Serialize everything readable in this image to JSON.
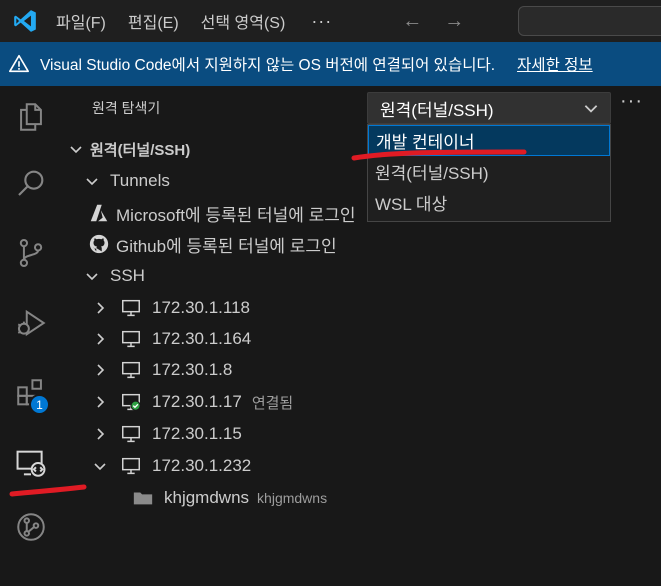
{
  "menu": [
    "파일(F)",
    "편집(E)",
    "선택 영역(S)"
  ],
  "menu_more": "···",
  "nav": {
    "back": "←",
    "forward": "→"
  },
  "banner": {
    "text": "Visual Studio Code에서 지원하지 않는 OS 버전에 연결되어 있습니다.",
    "link": "자세한 정보"
  },
  "activity": {
    "badge": "1"
  },
  "sidebar": {
    "title": "원격 탐색기",
    "select_value": "원격(터널/SSH)",
    "more": "···",
    "dropdown": [
      "개발 컨테이너",
      "원격(터널/SSH)",
      "WSL 대상"
    ],
    "section": "원격(터널/SSH)",
    "tunnels": {
      "label": "Tunnels",
      "microsoft": "Microsoft에 등록된 터널에 로그인",
      "github": "Github에 등록된 터널에 로그인"
    },
    "ssh": {
      "label": "SSH",
      "hosts": [
        {
          "name": "172.30.1.118",
          "desc": ""
        },
        {
          "name": "172.30.1.164",
          "desc": ""
        },
        {
          "name": "172.30.1.8",
          "desc": ""
        },
        {
          "name": "172.30.1.17",
          "desc": "연결됨"
        },
        {
          "name": "172.30.1.15",
          "desc": ""
        },
        {
          "name": "172.30.1.232",
          "desc": ""
        }
      ],
      "folder": {
        "name": "khjgmdwns",
        "desc": "khjgmdwns"
      }
    }
  },
  "colors": {
    "accent": "#0078d4",
    "banner": "#0a4c80",
    "annotation": "#e01b24"
  }
}
